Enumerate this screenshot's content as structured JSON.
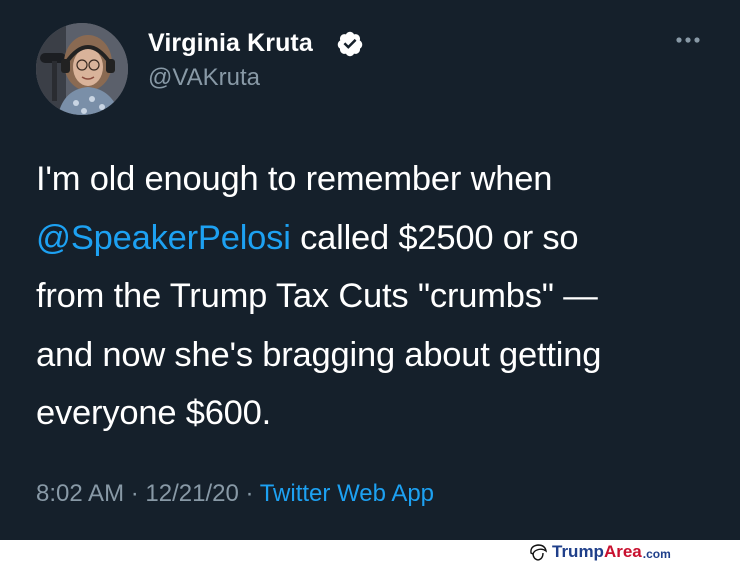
{
  "tweet": {
    "author": {
      "display_name": "Virginia Kruta",
      "handle": "@VAKruta",
      "verified": true
    },
    "body": {
      "line1": "I'm old enough to remember when",
      "mention": "@SpeakerPelosi",
      "line2_rest": " called $2500 or so",
      "line3": "from the Trump Tax Cuts \"crumbs\" —",
      "line4": "and now she's bragging about getting",
      "line5": "everyone $600."
    },
    "meta": {
      "time": "8:02 AM",
      "separator1": " · ",
      "date": "12/21/20",
      "separator2": " · ",
      "source": "Twitter Web App"
    },
    "icons": {
      "verified": "verified-badge-icon",
      "more": "more-options-icon"
    },
    "colors": {
      "background": "#15202b",
      "text": "#ffffff",
      "secondary": "#8899a6",
      "accent": "#1da1f2"
    }
  },
  "watermark": {
    "part1": "Trump",
    "part2": "Area",
    "part3": ".com",
    "colors": {
      "blue": "#1f3f8a",
      "red": "#c8102e"
    }
  }
}
